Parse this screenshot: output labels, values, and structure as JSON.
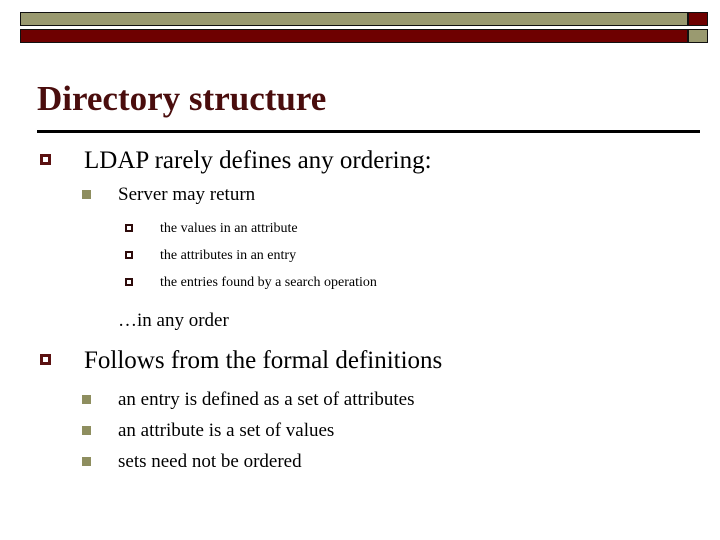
{
  "slide": {
    "title": "Directory structure",
    "decoration": {
      "tan_color": "#9a9a70",
      "red_color": "#6e0000",
      "border_color": "#111111"
    },
    "title_color": "#4a0d0d",
    "bullets": {
      "level1_marker": "hollow-square-maroon",
      "level2_marker": "filled-square-olive",
      "level3_marker": "hollow-square-dark"
    },
    "content": [
      {
        "level": 1,
        "text": "LDAP rarely defines any ordering:"
      },
      {
        "level": 2,
        "text": "Server may return"
      },
      {
        "level": 3,
        "text": "the values in an attribute"
      },
      {
        "level": 3,
        "text": "the attributes in an entry"
      },
      {
        "level": 3,
        "text": "the entries found by a search operation"
      },
      {
        "level": 2,
        "text": "…in any order",
        "no_marker": true
      },
      {
        "level": 1,
        "text": "Follows from the formal definitions"
      },
      {
        "level": 2,
        "text": "an entry is defined as a set of attributes"
      },
      {
        "level": 2,
        "text": "an attribute is a set of values"
      },
      {
        "level": 2,
        "text": "sets need not be ordered"
      }
    ]
  }
}
